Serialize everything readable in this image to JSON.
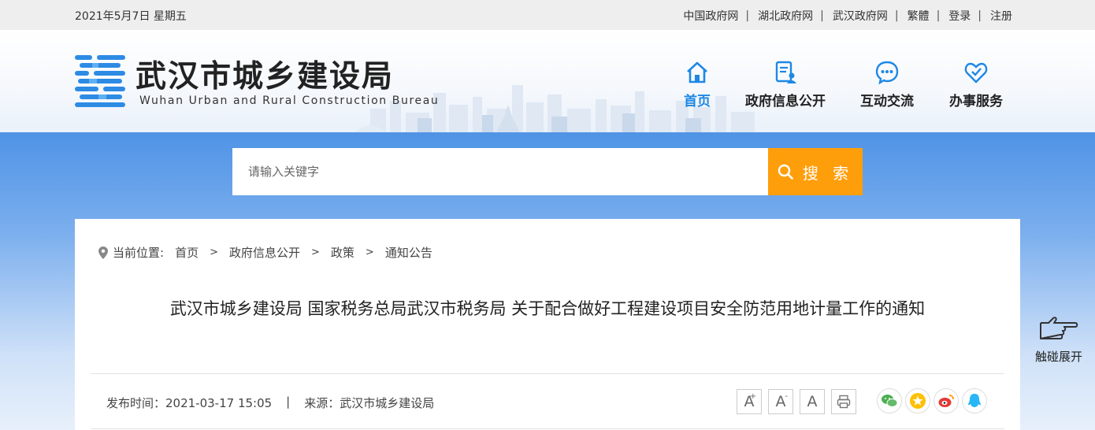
{
  "topbar": {
    "date": "2021年5月7日 星期五",
    "links": [
      "中国政府网",
      "湖北政府网",
      "武汉政府网",
      "繁體",
      "登录",
      "注册"
    ]
  },
  "header": {
    "title": "武汉市城乡建设局",
    "subtitle": "Wuhan Urban and Rural Construction Bureau",
    "nav": [
      {
        "label": "首页",
        "icon": "home-icon",
        "active": true
      },
      {
        "label": "政府信息公开",
        "icon": "document-user-icon",
        "active": false
      },
      {
        "label": "互动交流",
        "icon": "chat-bubble-icon",
        "active": false
      },
      {
        "label": "办事服务",
        "icon": "heart-service-icon",
        "active": false
      }
    ]
  },
  "search": {
    "placeholder": "请输入关键字",
    "button_label": "搜 索"
  },
  "breadcrumb": {
    "prefix": "当前位置:",
    "items": [
      "首页",
      "政府信息公开",
      "政策",
      "通知公告"
    ],
    "separator": ">"
  },
  "article": {
    "title": "武汉市城乡建设局 国家税务总局武汉市税务局 关于配合做好工程建设项目安全防范用地计量工作的通知",
    "publish_time": "发布时间：2021-03-17 15:05",
    "meta_separator": "|",
    "source": "来源：武汉市城乡建设局"
  },
  "font_tools": {
    "increase": "A",
    "increase_sup": "+",
    "decrease": "A",
    "decrease_sup": "-",
    "reset": "A"
  },
  "share_icons": [
    "wechat-icon",
    "favorite-star-icon",
    "weibo-icon",
    "qq-icon"
  ],
  "side": {
    "touch_label": "触碰展开"
  },
  "colors": {
    "accent_blue": "#1e88e5",
    "search_orange": "#ff9e0b",
    "band_blue": "#4f93e6"
  }
}
